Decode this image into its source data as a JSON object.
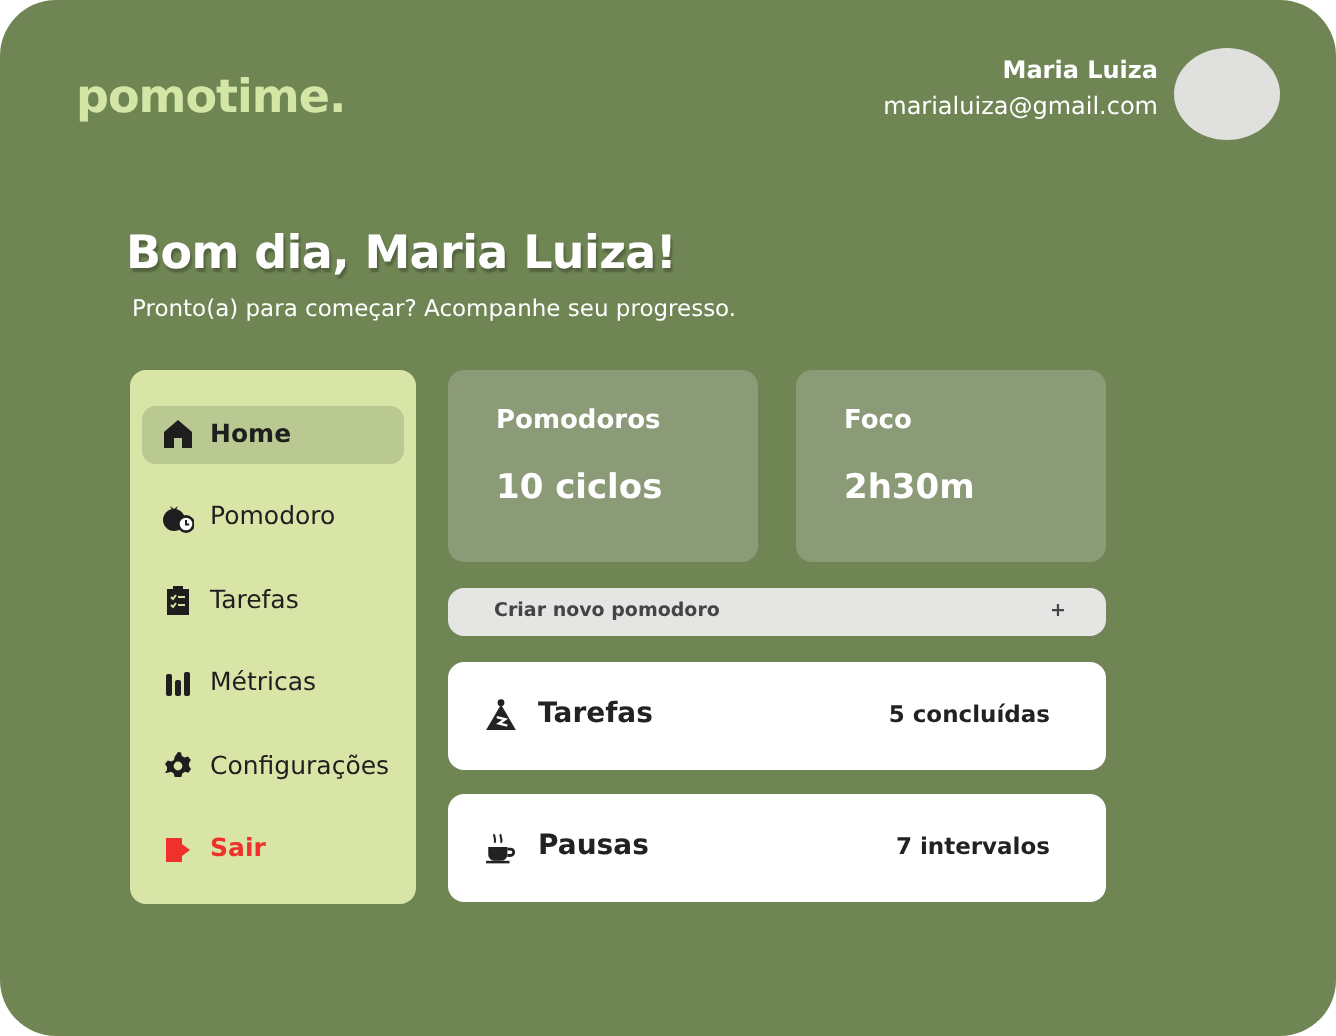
{
  "logo": "pomotime.",
  "user": {
    "name": "Maria Luiza",
    "email": "marialuiza@gmail.com"
  },
  "greeting": {
    "title": "Bom dia, Maria Luiza!",
    "subtitle": "Pronto(a) para começar? Acompanhe seu progresso."
  },
  "sidebar": {
    "items": [
      {
        "label": "Home",
        "kind": "home",
        "selected": true,
        "color": "#1e1e1e"
      },
      {
        "label": "Pomodoro",
        "kind": "pomodoro",
        "selected": false,
        "color": "#1e1e1e"
      },
      {
        "label": "Tarefas",
        "kind": "tasks",
        "selected": false,
        "color": "#1e1e1e"
      },
      {
        "label": "Métricas",
        "kind": "metrics",
        "selected": false,
        "color": "#1e1e1e"
      },
      {
        "label": "Configurações",
        "kind": "settings",
        "selected": false,
        "color": "#1e1e1e"
      },
      {
        "label": "Sair",
        "kind": "logout",
        "selected": false,
        "color": "#f0302a"
      }
    ]
  },
  "stats": [
    {
      "label": "Pomodoros",
      "value": "10 ciclos"
    },
    {
      "label": "Foco",
      "value": "2h30m"
    }
  ],
  "create_button": {
    "label": "Criar novo pomodoro",
    "symbol": "+"
  },
  "summary": [
    {
      "kind": "tasks",
      "label": "Tarefas",
      "value": "5 concluídas"
    },
    {
      "kind": "breaks",
      "label": "Pausas",
      "value": "7 intervalos"
    }
  ]
}
